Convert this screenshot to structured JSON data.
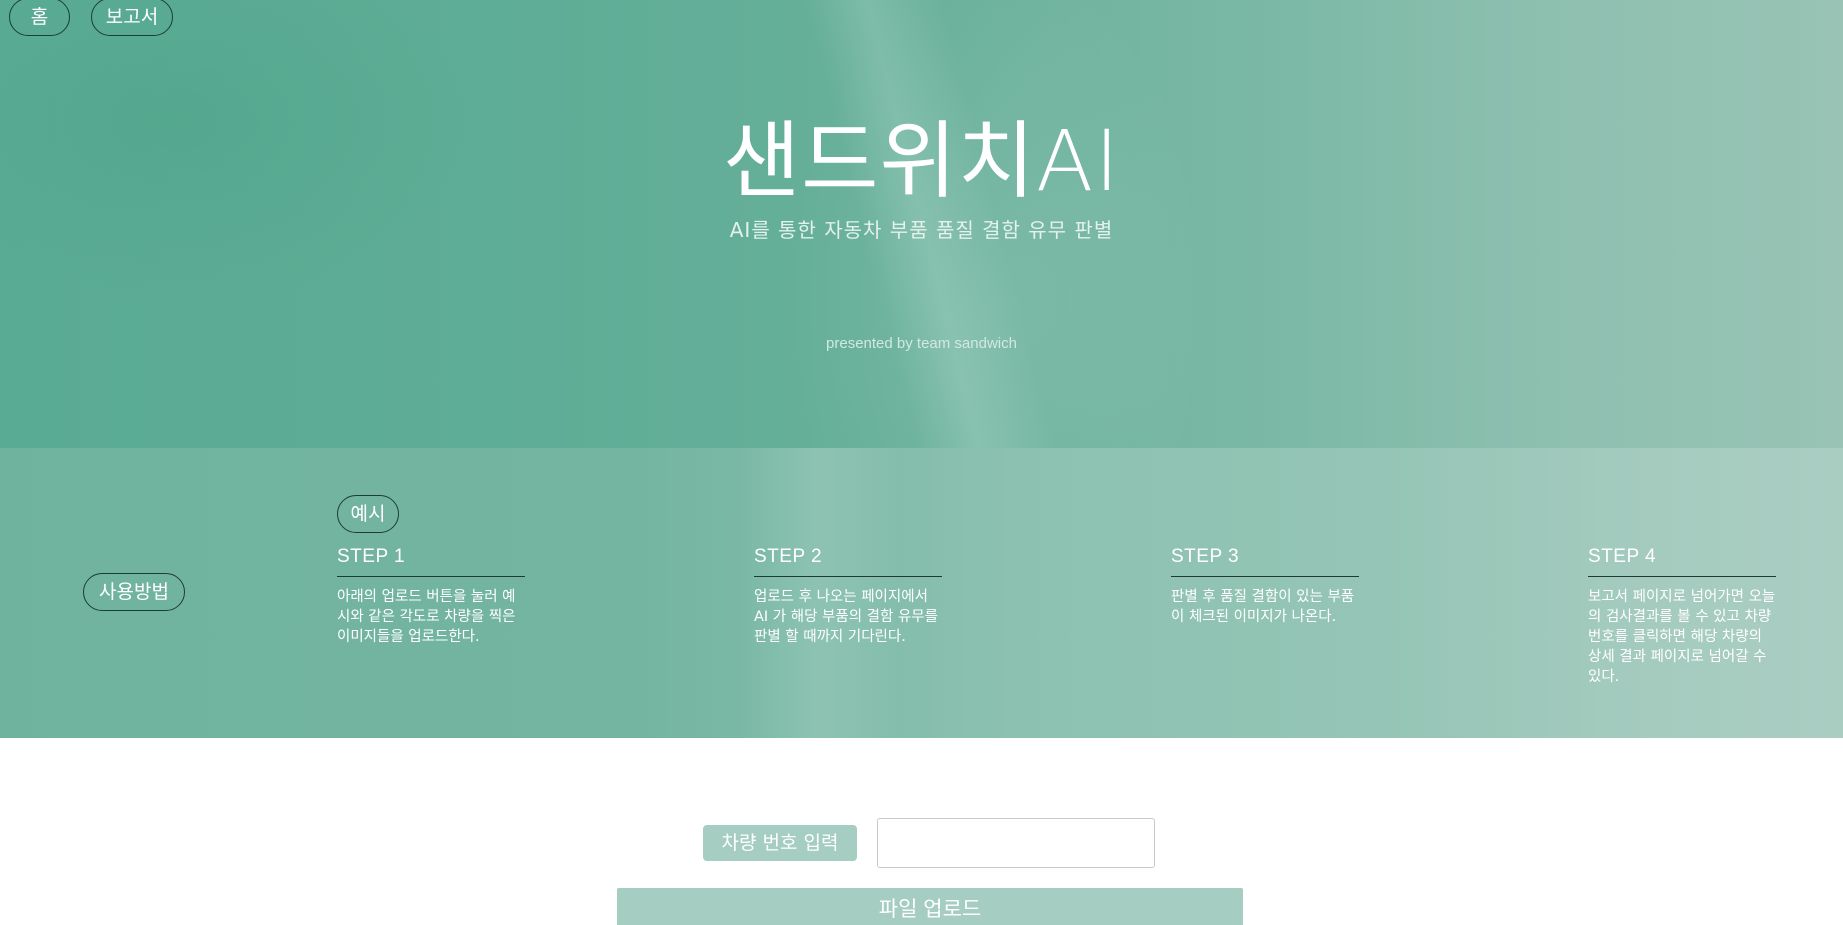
{
  "nav": {
    "home_label": "홈",
    "report_label": "보고서"
  },
  "hero": {
    "title": "샌드위치AI",
    "subtitle": "AI를 통한 자동차 부품 품질 결함 유무 판별",
    "credit": "presented by team sandwich"
  },
  "usage": {
    "section_label": "사용방법",
    "example_label": "예시",
    "steps": [
      {
        "title": "STEP 1",
        "desc": "아래의 업로드 버튼을 눌러 예시와 같은 각도로 차량을 찍은 이미지들을 업로드한다."
      },
      {
        "title": "STEP 2",
        "desc": "업로드 후 나오는 페이지에서 AI 가 해당 부품의 결함 유무를 판별 할 때까지 기다린다."
      },
      {
        "title": "STEP 3",
        "desc": "판별 후 품질 결함이 있는 부품이 체크된 이미지가 나온다."
      },
      {
        "title": "STEP 4",
        "desc": "보고서 페이지로 넘어가면 오늘의 검사결과를 볼 수 있고 차량번호를 클릭하면 해당 차량의 상세 결과 페이지로 넘어갈 수 있다."
      }
    ]
  },
  "form": {
    "car_number_label": "차량 번호 입력",
    "car_number_value": "",
    "upload_label": "파일 업로드"
  },
  "colors": {
    "hero_primary": "#5fad96",
    "accent_button": "#a5cdc2",
    "outline_dark": "#1d3d33"
  }
}
